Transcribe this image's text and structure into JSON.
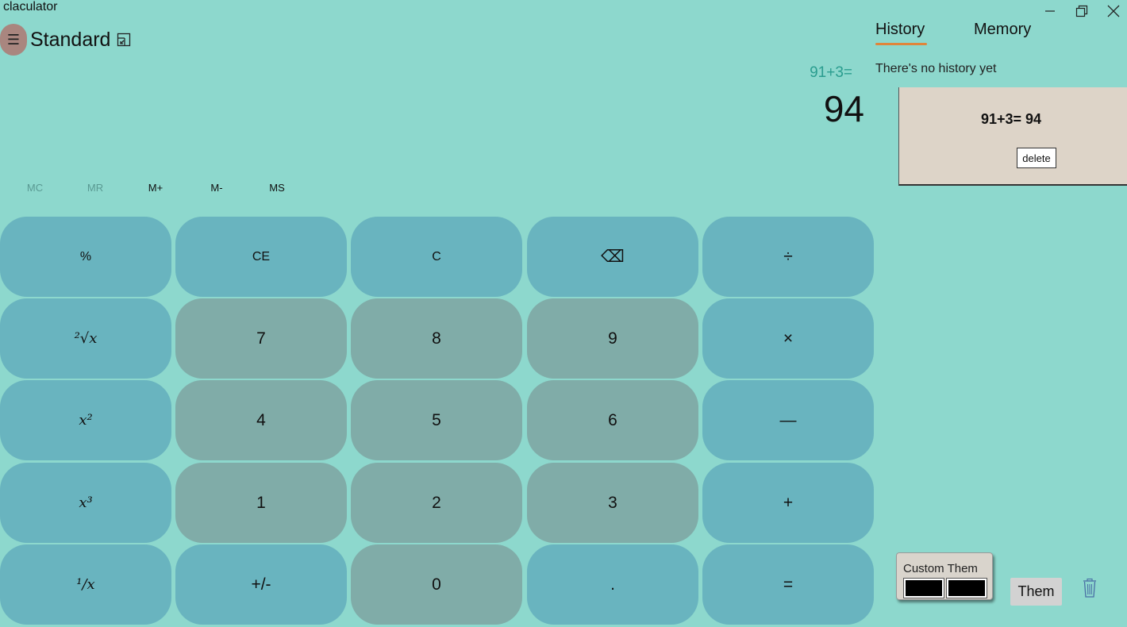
{
  "window": {
    "title": "claculator",
    "minimize_icon": "minimize-icon",
    "maximize_icon": "restore-icon",
    "close_icon": "close-icon"
  },
  "header": {
    "menu_icon": "☰",
    "mode": "Standard",
    "keep_on_top_icon": "keep-on-top-icon"
  },
  "display": {
    "expression": "91+3=",
    "value": "94"
  },
  "memory": {
    "buttons": [
      {
        "label": "MC",
        "enabled": false
      },
      {
        "label": "MR",
        "enabled": false
      },
      {
        "label": "M+",
        "enabled": true
      },
      {
        "label": "M-",
        "enabled": true
      },
      {
        "label": "MS",
        "enabled": true
      }
    ]
  },
  "keypad": {
    "rows": [
      [
        "%",
        "CE",
        "C",
        "⌫",
        "÷"
      ],
      [
        "²√x",
        "7",
        "8",
        "9",
        "×"
      ],
      [
        "x²",
        "4",
        "5",
        "6",
        "—"
      ],
      [
        "x³",
        "1",
        "2",
        "3",
        "+"
      ],
      [
        "¹/x",
        "+/-",
        "0",
        ".",
        "="
      ]
    ]
  },
  "panel": {
    "tabs": [
      {
        "label": "History",
        "active": true
      },
      {
        "label": "Memory",
        "active": false
      }
    ],
    "empty_message": "There's no history yet",
    "history": [
      {
        "entry": "91+3= 94",
        "delete_label": "delete"
      }
    ]
  },
  "theme": {
    "custom_label": "Custom Them",
    "button_label": "Them",
    "trash_icon": "trash-icon"
  },
  "colors": {
    "background": "#8dd8cd",
    "operator_key": "#69b4bf",
    "number_key": "#80aca8",
    "expression_text": "#2a9d8f",
    "tab_underline": "#e0853a",
    "history_card": "#ddd4c8"
  }
}
